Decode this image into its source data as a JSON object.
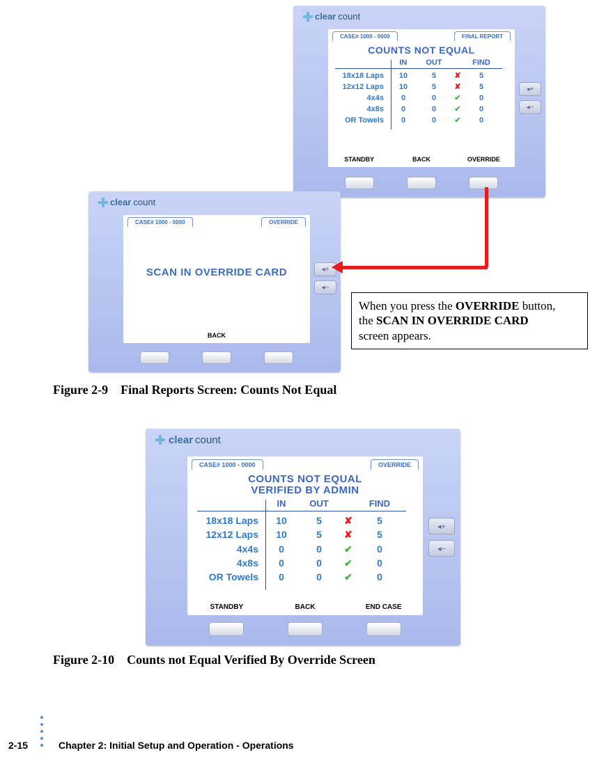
{
  "brand": {
    "clear": "clear",
    "count": "count"
  },
  "device1": {
    "case_tab": "CASE# 1000 - 0000",
    "right_tab": "FINAL REPORT",
    "title": "COUNTS NOT EQUAL",
    "cols": {
      "in": "IN",
      "out": "OUT",
      "find": "FIND"
    },
    "rows": [
      {
        "name": "18x18 Laps",
        "in": "10",
        "out": "5",
        "mark": "✘",
        "ok": false,
        "find": "5"
      },
      {
        "name": "12x12 Laps",
        "in": "10",
        "out": "5",
        "mark": "✘",
        "ok": false,
        "find": "5"
      },
      {
        "name": "4x4s",
        "in": "0",
        "out": "0",
        "mark": "✔",
        "ok": true,
        "find": "0"
      },
      {
        "name": "4x8s",
        "in": "0",
        "out": "0",
        "mark": "✔",
        "ok": true,
        "find": "0"
      },
      {
        "name": "OR Towels",
        "in": "0",
        "out": "0",
        "mark": "✔",
        "ok": true,
        "find": "0"
      }
    ],
    "buttons": {
      "left": "STANDBY",
      "mid": "BACK",
      "right": "OVERRIDE"
    }
  },
  "device2": {
    "case_tab": "CASE# 1000 - 0000",
    "right_tab": "OVERRIDE",
    "body": "SCAN IN OVERRIDE CARD",
    "buttons": {
      "mid": "BACK"
    }
  },
  "device3": {
    "case_tab": "CASE# 1000 - 0000",
    "right_tab": "OVERRIDE",
    "title1": "COUNTS NOT EQUAL",
    "title2": "VERIFIED BY ADMIN",
    "cols": {
      "in": "IN",
      "out": "OUT",
      "find": "FIND"
    },
    "rows": [
      {
        "name": "18x18 Laps",
        "in": "10",
        "out": "5",
        "mark": "✘",
        "ok": false,
        "find": "5"
      },
      {
        "name": "12x12 Laps",
        "in": "10",
        "out": "5",
        "mark": "✘",
        "ok": false,
        "find": "5"
      },
      {
        "name": "4x4s",
        "in": "0",
        "out": "0",
        "mark": "✔",
        "ok": true,
        "find": "0"
      },
      {
        "name": "4x8s",
        "in": "0",
        "out": "0",
        "mark": "✔",
        "ok": true,
        "find": "0"
      },
      {
        "name": "OR Towels",
        "in": "0",
        "out": "0",
        "mark": "✔",
        "ok": true,
        "find": "0"
      }
    ],
    "buttons": {
      "left": "STANDBY",
      "mid": "BACK",
      "right": "END CASE"
    }
  },
  "callout": {
    "l1a": "When you press the ",
    "l1b": "OVERRIDE",
    "l1c": " button,",
    "l2a": "the ",
    "l2b": "SCAN IN OVERRIDE CARD",
    "l3": "screen appears."
  },
  "capt1_num": "Figure 2-9",
  "capt1_txt": "Final Reports Screen: Counts Not Equal",
  "capt2_num": "Figure 2-10",
  "capt2_txt": "Counts not Equal Verified By Override Screen",
  "footer": {
    "page": "2-15",
    "chapter": "Chapter 2: Initial Setup and Operation - Operations"
  }
}
